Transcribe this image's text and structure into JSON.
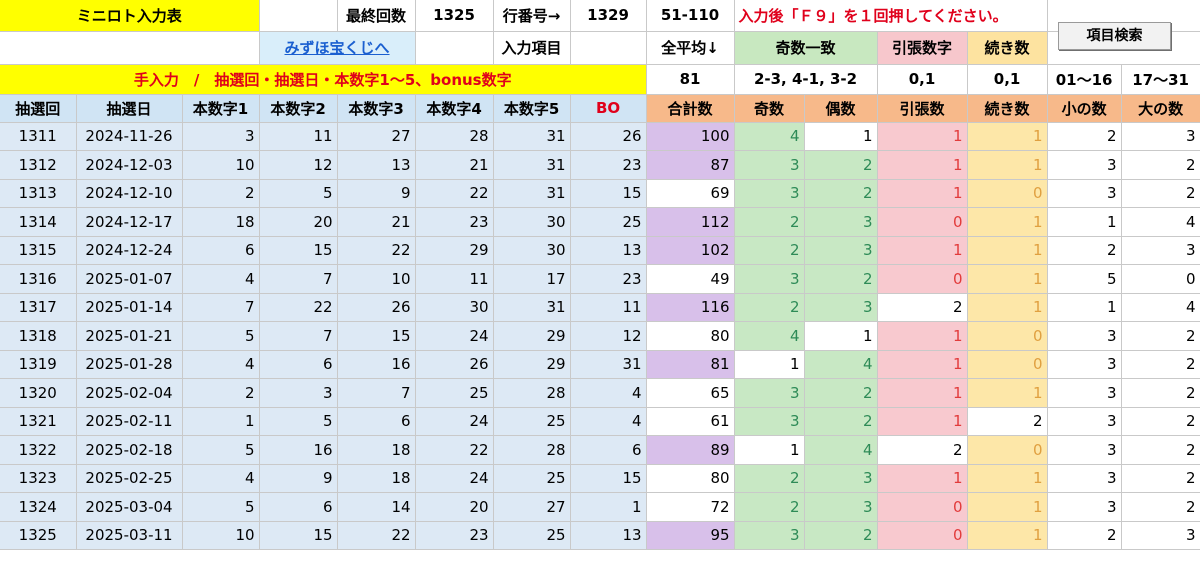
{
  "top": {
    "title": "ミニロト入力表",
    "last_count_label": "最終回数",
    "last_count": "1325",
    "row_no_label": "行番号→",
    "row_no": "1329",
    "range": "51-110",
    "notice": "入力後「Ｆ９」を１回押してください。",
    "link": "みずほ宝くじへ",
    "input_item_label": "入力項目",
    "avg_label": "全平均↓",
    "odd_match_label": "奇数一致",
    "pull_label": "引張数字",
    "consec_label": "続き数",
    "search_button": "項目検索",
    "manual_input": "手入力　/　抽選回・抽選日・本数字1〜5、bonus数字",
    "avg_value": "81",
    "odd_match_value": "2-3, 4-1, 3-2",
    "pull_value": "0,1",
    "consec_value": "0,1",
    "small_range": "01〜16",
    "large_range": "17〜31"
  },
  "columns": [
    "抽選回",
    "抽選日",
    "本数字1",
    "本数字2",
    "本数字3",
    "本数字4",
    "本数字5",
    "BO",
    "合計数",
    "奇数",
    "偶数",
    "引張数",
    "続き数",
    "小の数",
    "大の数"
  ],
  "colors": {
    "yellow": "#ffff00",
    "red": "#e0001b",
    "purple": "#d8c0ea",
    "green": "#c8e8c4",
    "pink": "#f8c9cf",
    "gold": "#fde7a8",
    "blue": "#dde9f5"
  },
  "rows": [
    {
      "no": "1311",
      "date": "2024-11-26",
      "n1": "3",
      "n2": "11",
      "n3": "27",
      "n4": "28",
      "n5": "31",
      "bo": "26",
      "sum": "100",
      "odd": "4",
      "even": "1",
      "pull": "1",
      "cont": "1",
      "small": "2",
      "large": "3"
    },
    {
      "no": "1312",
      "date": "2024-12-03",
      "n1": "10",
      "n2": "12",
      "n3": "13",
      "n4": "21",
      "n5": "31",
      "bo": "23",
      "sum": "87",
      "odd": "3",
      "even": "2",
      "pull": "1",
      "cont": "1",
      "small": "3",
      "large": "2"
    },
    {
      "no": "1313",
      "date": "2024-12-10",
      "n1": "2",
      "n2": "5",
      "n3": "9",
      "n4": "22",
      "n5": "31",
      "bo": "15",
      "sum": "69",
      "odd": "3",
      "even": "2",
      "pull": "1",
      "cont": "0",
      "small": "3",
      "large": "2"
    },
    {
      "no": "1314",
      "date": "2024-12-17",
      "n1": "18",
      "n2": "20",
      "n3": "21",
      "n4": "23",
      "n5": "30",
      "bo": "25",
      "sum": "112",
      "odd": "2",
      "even": "3",
      "pull": "0",
      "cont": "1",
      "small": "1",
      "large": "4"
    },
    {
      "no": "1315",
      "date": "2024-12-24",
      "n1": "6",
      "n2": "15",
      "n3": "22",
      "n4": "29",
      "n5": "30",
      "bo": "13",
      "sum": "102",
      "odd": "2",
      "even": "3",
      "pull": "1",
      "cont": "1",
      "small": "2",
      "large": "3"
    },
    {
      "no": "1316",
      "date": "2025-01-07",
      "n1": "4",
      "n2": "7",
      "n3": "10",
      "n4": "11",
      "n5": "17",
      "bo": "23",
      "sum": "49",
      "odd": "3",
      "even": "2",
      "pull": "0",
      "cont": "1",
      "small": "5",
      "large": "0"
    },
    {
      "no": "1317",
      "date": "2025-01-14",
      "n1": "7",
      "n2": "22",
      "n3": "26",
      "n4": "30",
      "n5": "31",
      "bo": "11",
      "sum": "116",
      "odd": "2",
      "even": "3",
      "pull": "2",
      "cont": "1",
      "small": "1",
      "large": "4"
    },
    {
      "no": "1318",
      "date": "2025-01-21",
      "n1": "5",
      "n2": "7",
      "n3": "15",
      "n4": "24",
      "n5": "29",
      "bo": "12",
      "sum": "80",
      "odd": "4",
      "even": "1",
      "pull": "1",
      "cont": "0",
      "small": "3",
      "large": "2"
    },
    {
      "no": "1319",
      "date": "2025-01-28",
      "n1": "4",
      "n2": "6",
      "n3": "16",
      "n4": "26",
      "n5": "29",
      "bo": "31",
      "sum": "81",
      "odd": "1",
      "even": "4",
      "pull": "1",
      "cont": "0",
      "small": "3",
      "large": "2"
    },
    {
      "no": "1320",
      "date": "2025-02-04",
      "n1": "2",
      "n2": "3",
      "n3": "7",
      "n4": "25",
      "n5": "28",
      "bo": "4",
      "sum": "65",
      "odd": "3",
      "even": "2",
      "pull": "1",
      "cont": "1",
      "small": "3",
      "large": "2"
    },
    {
      "no": "1321",
      "date": "2025-02-11",
      "n1": "1",
      "n2": "5",
      "n3": "6",
      "n4": "24",
      "n5": "25",
      "bo": "4",
      "sum": "61",
      "odd": "3",
      "even": "2",
      "pull": "1",
      "cont": "2",
      "small": "3",
      "large": "2"
    },
    {
      "no": "1322",
      "date": "2025-02-18",
      "n1": "5",
      "n2": "16",
      "n3": "18",
      "n4": "22",
      "n5": "28",
      "bo": "6",
      "sum": "89",
      "odd": "1",
      "even": "4",
      "pull": "2",
      "cont": "0",
      "small": "3",
      "large": "2"
    },
    {
      "no": "1323",
      "date": "2025-02-25",
      "n1": "4",
      "n2": "9",
      "n3": "18",
      "n4": "24",
      "n5": "25",
      "bo": "15",
      "sum": "80",
      "odd": "2",
      "even": "3",
      "pull": "1",
      "cont": "1",
      "small": "3",
      "large": "2"
    },
    {
      "no": "1324",
      "date": "2025-03-04",
      "n1": "5",
      "n2": "6",
      "n3": "14",
      "n4": "20",
      "n5": "27",
      "bo": "1",
      "sum": "72",
      "odd": "2",
      "even": "3",
      "pull": "0",
      "cont": "1",
      "small": "3",
      "large": "2"
    },
    {
      "no": "1325",
      "date": "2025-03-11",
      "n1": "10",
      "n2": "15",
      "n3": "22",
      "n4": "23",
      "n5": "25",
      "bo": "13",
      "sum": "95",
      "odd": "3",
      "even": "2",
      "pull": "0",
      "cont": "1",
      "small": "2",
      "large": "3"
    }
  ]
}
